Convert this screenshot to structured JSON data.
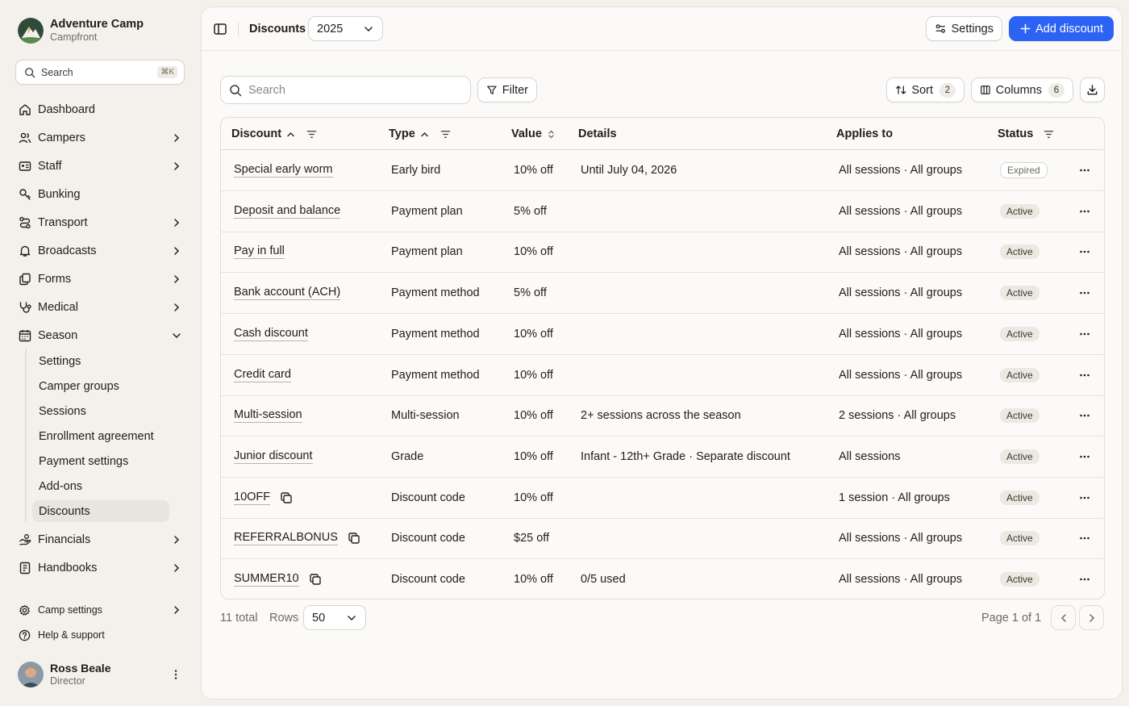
{
  "brand": {
    "name": "Adventure Camp",
    "subtitle": "Campfront"
  },
  "sidebar": {
    "search_label": "Search",
    "search_shortcut": "⌘K",
    "nav": [
      {
        "label": "Dashboard",
        "icon": "home-icon"
      },
      {
        "label": "Campers",
        "icon": "users-icon"
      },
      {
        "label": "Staff",
        "icon": "id-card-icon"
      },
      {
        "label": "Bunking",
        "icon": "bunk-icon"
      },
      {
        "label": "Transport",
        "icon": "route-icon"
      },
      {
        "label": "Broadcasts",
        "icon": "bell-icon"
      },
      {
        "label": "Forms",
        "icon": "forms-icon"
      },
      {
        "label": "Medical",
        "icon": "stethoscope-icon"
      },
      {
        "label": "Season",
        "icon": "calendar-icon"
      }
    ],
    "season_items": [
      "Settings",
      "Camper groups",
      "Sessions",
      "Enrollment agreement",
      "Payment settings",
      "Add-ons",
      "Discounts"
    ],
    "nav_bottom": [
      {
        "label": "Financials",
        "icon": "coins-icon"
      },
      {
        "label": "Handbooks",
        "icon": "book-icon"
      }
    ],
    "camp_settings": "Camp settings",
    "help": "Help & support",
    "user": {
      "name": "Ross Beale",
      "role": "Director"
    }
  },
  "header": {
    "breadcrumb": "Discounts",
    "year": "2025",
    "settings_label": "Settings",
    "add_label": "Add discount",
    "accent": "#2d63f5"
  },
  "toolbar": {
    "search_placeholder": "Search",
    "filter_label": "Filter",
    "sort_label": "Sort",
    "sort_count": "2",
    "columns_label": "Columns",
    "columns_count": "6"
  },
  "table": {
    "headers": {
      "discount": "Discount",
      "type": "Type",
      "value": "Value",
      "details": "Details",
      "applies": "Applies to",
      "status": "Status"
    },
    "rows": [
      {
        "name": "Special early worm",
        "copy": false,
        "type": "Early bird",
        "value": "10% off",
        "details": "Until July 04, 2026",
        "applies": "All sessions · All groups",
        "status": "Expired"
      },
      {
        "name": "Deposit and balance",
        "copy": false,
        "type": "Payment plan",
        "value": "5% off",
        "details": "",
        "applies": "All sessions · All groups",
        "status": "Active"
      },
      {
        "name": "Pay in full",
        "copy": false,
        "type": "Payment plan",
        "value": "10% off",
        "details": "",
        "applies": "All sessions · All groups",
        "status": "Active"
      },
      {
        "name": "Bank account (ACH)",
        "copy": false,
        "type": "Payment method",
        "value": "5% off",
        "details": "",
        "applies": "All sessions · All groups",
        "status": "Active"
      },
      {
        "name": "Cash discount",
        "copy": false,
        "type": "Payment method",
        "value": "10% off",
        "details": "",
        "applies": "All sessions · All groups",
        "status": "Active"
      },
      {
        "name": "Credit card",
        "copy": false,
        "type": "Payment method",
        "value": "10% off",
        "details": "",
        "applies": "All sessions · All groups",
        "status": "Active"
      },
      {
        "name": "Multi-session",
        "copy": false,
        "type": "Multi-session",
        "value": "10% off",
        "details": "2+ sessions across the season",
        "applies": "2 sessions · All groups",
        "status": "Active"
      },
      {
        "name": "Junior discount",
        "copy": false,
        "type": "Grade",
        "value": "10% off",
        "details": "Infant - 12th+ Grade · Separate discount",
        "applies": "All sessions",
        "status": "Active"
      },
      {
        "name": "10OFF",
        "copy": true,
        "type": "Discount code",
        "value": "10% off",
        "details": "",
        "applies": "1 session · All groups",
        "status": "Active"
      },
      {
        "name": "REFERRALBONUS",
        "copy": true,
        "type": "Discount code",
        "value": "$25 off",
        "details": "",
        "applies": "All sessions · All groups",
        "status": "Active"
      },
      {
        "name": "SUMMER10",
        "copy": true,
        "type": "Discount code",
        "value": "10% off",
        "details": "0/5 used",
        "applies": "All sessions · All groups",
        "status": "Active"
      }
    ]
  },
  "footer": {
    "total": "11 total",
    "rows_label": "Rows",
    "rows_value": "50",
    "page_info": "Page 1 of 1"
  }
}
